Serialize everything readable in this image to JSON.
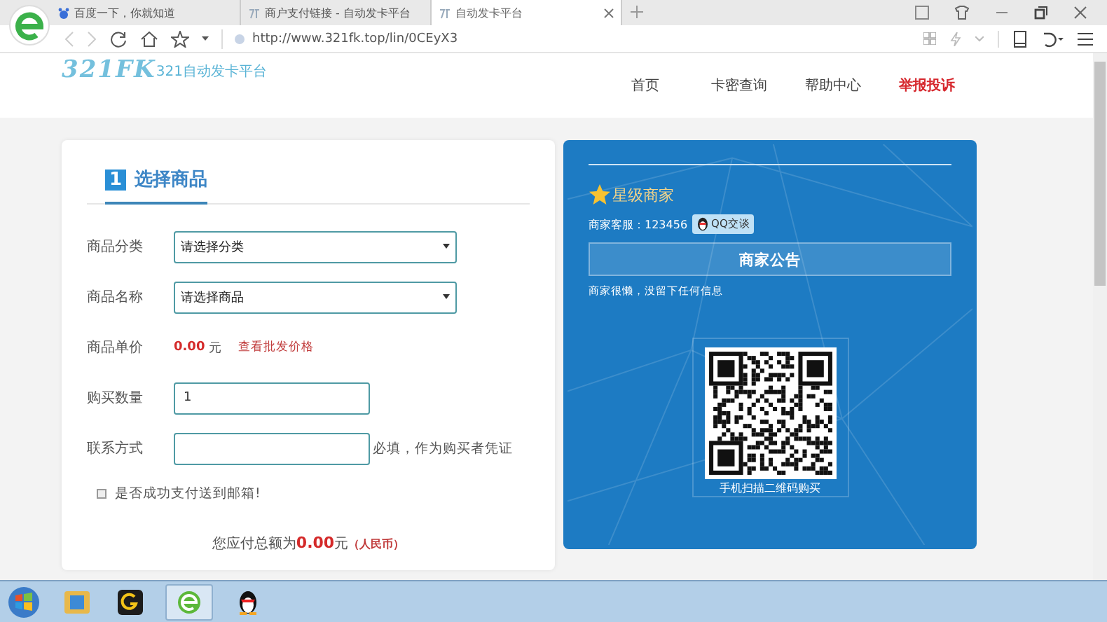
{
  "browser": {
    "tabs": [
      {
        "label": "百度一下，你就知道",
        "selected": false
      },
      {
        "label": "商户支付链接 - 自动发卡平台",
        "selected": false
      },
      {
        "label": "自动发卡平台",
        "selected": true
      }
    ],
    "url": "http://www.321fk.top/lin/0CEyX3"
  },
  "header": {
    "logo_text": "321FK",
    "logo_subtitle": "321自动发卡平台",
    "nav": [
      {
        "label": "首页",
        "highlighted": false
      },
      {
        "label": "卡密查询",
        "highlighted": false
      },
      {
        "label": "帮助中心",
        "highlighted": false
      },
      {
        "label": "举报投诉",
        "highlighted": true
      }
    ]
  },
  "form": {
    "step_number": "1",
    "title": "选择商品",
    "rows": [
      {
        "kind": "select",
        "label": "商品分类",
        "value": "请选择分类"
      },
      {
        "kind": "select",
        "label": "商品名称",
        "value": "请选择商品"
      },
      {
        "kind": "price",
        "label": "商品单价",
        "price": "0.00",
        "unit": "元",
        "link": "查看批发价格"
      },
      {
        "kind": "input",
        "label": "购买数量",
        "value": "1"
      },
      {
        "kind": "input",
        "label": "联系方式",
        "note": "必填，作为购买者凭证"
      }
    ],
    "checkbox": {
      "label": "是否成功支付送到邮箱!",
      "checked": false
    },
    "total": {
      "prefix": "您应付总额为",
      "amount": "0.00",
      "unit": "元",
      "currency": "（人民币）"
    }
  },
  "merchant": {
    "badge": "星级商家",
    "service": "商家客服：123456",
    "qq_button": "QQ交谈",
    "notice_title": "商家公告",
    "notice_text": "商家很懒，没留下任何信息",
    "qr_caption": "手机扫描二维码购买"
  },
  "taskbar": {
    "items": [
      {
        "kind": "start",
        "selected": false
      },
      {
        "kind": "explorer",
        "selected": false
      },
      {
        "kind": "app",
        "selected": false
      },
      {
        "kind": "browser",
        "selected": true
      },
      {
        "kind": "chat",
        "selected": false
      }
    ]
  }
}
